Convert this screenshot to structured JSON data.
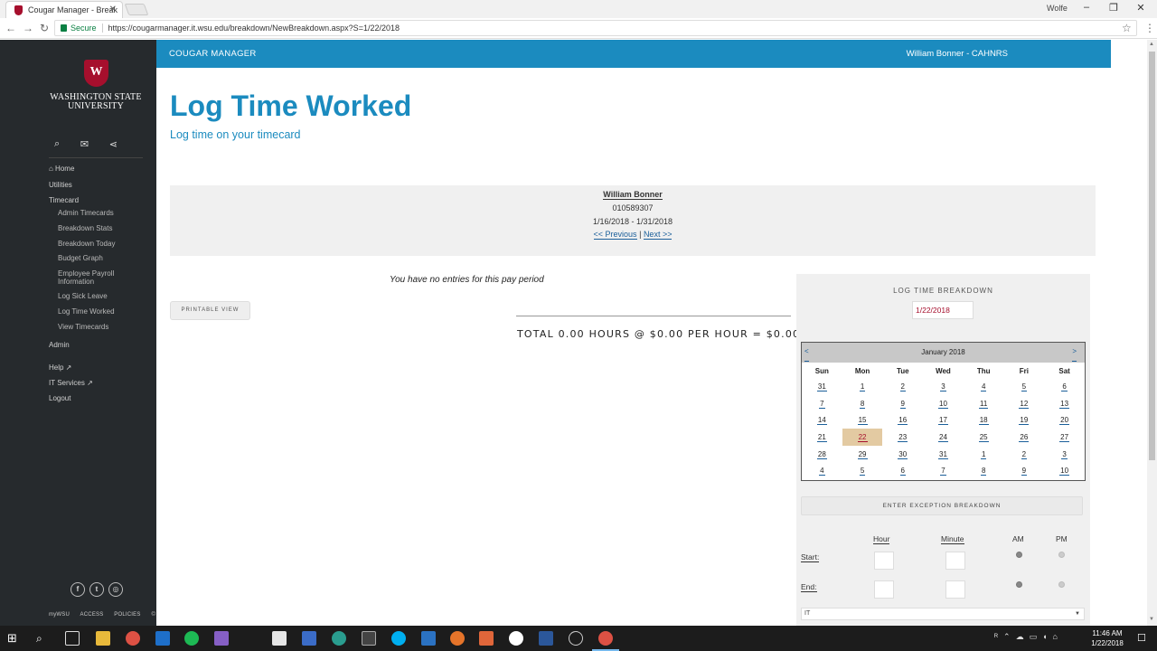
{
  "browser": {
    "tab_title": "Cougar Manager - Break",
    "tab_close": "✕",
    "window_user": "Wolfe",
    "url": "https://cougarmanager.it.wsu.edu/breakdown/NewBreakdown.aspx?S=1/22/2018",
    "secure_label": "Secure"
  },
  "sidebar": {
    "logo_line1": "WASHINGTON STATE",
    "logo_line2": "UNIVERSITY",
    "nav": [
      {
        "label": "⌂ Home"
      },
      {
        "label": "Utilities"
      },
      {
        "label": "Timecard"
      },
      {
        "label": "Admin Timecards"
      },
      {
        "label": "Breakdown Stats"
      },
      {
        "label": "Breakdown Today"
      },
      {
        "label": "Budget Graph"
      },
      {
        "label": "Employee Payroll Information"
      },
      {
        "label": "Log Sick Leave"
      },
      {
        "label": "Log Time Worked"
      },
      {
        "label": "View Timecards"
      },
      {
        "label": "Admin"
      },
      {
        "label": "Help ↗"
      },
      {
        "label": "IT Services ↗"
      },
      {
        "label": "Logout"
      }
    ],
    "footer": [
      "myWSU",
      "ACCESS",
      "POLICIES"
    ]
  },
  "header": {
    "brand": "COUGAR MANAGER",
    "user": "William Bonner - CAHNRS"
  },
  "page": {
    "title": "Log Time Worked",
    "subtitle": "Log time on your timecard"
  },
  "employee": {
    "name": "William Bonner",
    "id": "010589307",
    "period": "1/16/2018 - 1/31/2018",
    "prev_label": "<< Previous",
    "separator": "|",
    "next_label": "Next >>"
  },
  "entries": {
    "empty_message": "You have no entries for this pay period",
    "printable_label": "PRINTABLE VIEW",
    "total_text": "TOTAL 0.00 HOURS @ $0.00 PER HOUR = $0.00"
  },
  "breakdown": {
    "title": "LOG TIME BREAKDOWN",
    "date_value": "1/22/2018",
    "calendar": {
      "month_label": "January 2018",
      "prev": "<",
      "next": ">",
      "weekdays": [
        "Sun",
        "Mon",
        "Tue",
        "Wed",
        "Thu",
        "Fri",
        "Sat"
      ],
      "weeks": [
        [
          "31",
          "1",
          "2",
          "3",
          "4",
          "5",
          "6"
        ],
        [
          "7",
          "8",
          "9",
          "10",
          "11",
          "12",
          "13"
        ],
        [
          "14",
          "15",
          "16",
          "17",
          "18",
          "19",
          "20"
        ],
        [
          "21",
          "22",
          "23",
          "24",
          "25",
          "26",
          "27"
        ],
        [
          "28",
          "29",
          "30",
          "31",
          "1",
          "2",
          "3"
        ],
        [
          "4",
          "5",
          "6",
          "7",
          "8",
          "9",
          "10"
        ]
      ],
      "selected": "22"
    },
    "exception_label": "ENTER EXCEPTION BREAKDOWN",
    "hour_label": "Hour",
    "minute_label": "Minute",
    "am_label": "AM",
    "pm_label": "PM",
    "start_label": "Start:",
    "end_label": "End:",
    "start": {
      "hour": "",
      "minute": "",
      "ampm": "AM"
    },
    "end": {
      "hour": "",
      "minute": "",
      "ampm": "AM"
    },
    "department_value": "IT"
  },
  "taskbar": {
    "time": "11:46 AM",
    "date": "1/22/2018"
  },
  "colors": {
    "accent": "#1b8bbf",
    "sidebar_bg": "#262a2d",
    "wsu_crimson": "#a60f2d",
    "selected_day": "#e3caa2"
  }
}
